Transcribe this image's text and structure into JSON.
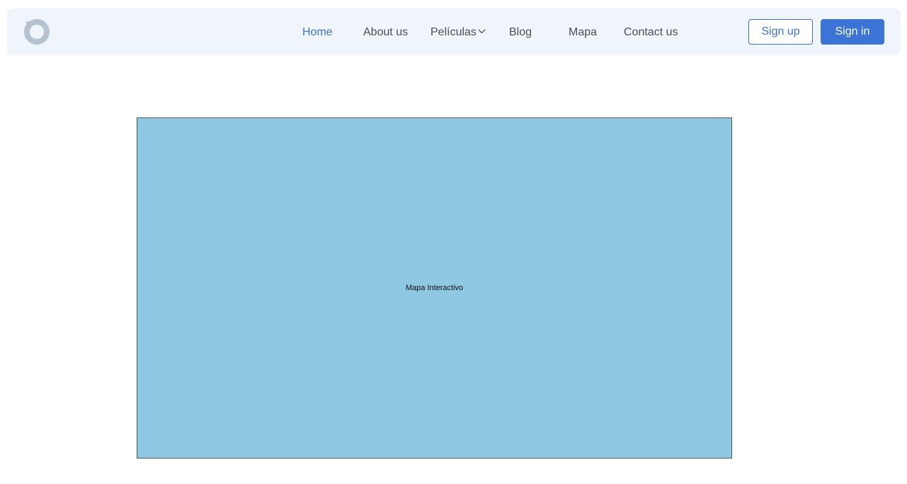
{
  "nav": {
    "items": [
      {
        "label": "Home",
        "active": true
      },
      {
        "label": "About us"
      },
      {
        "label": "Películas",
        "has_dropdown": true
      },
      {
        "label": "Blog"
      },
      {
        "label": "Mapa"
      },
      {
        "label": "Contact us"
      }
    ],
    "signup_label": "Sign up",
    "signin_label": "Sign in"
  },
  "logo_icon": "circular-logo-icon",
  "map": {
    "label": "Mapa Interactivo"
  },
  "colors": {
    "accent": "#3b73d6",
    "navbar_bg": "#f0f4fb",
    "map_bg": "#8fc8e2"
  }
}
